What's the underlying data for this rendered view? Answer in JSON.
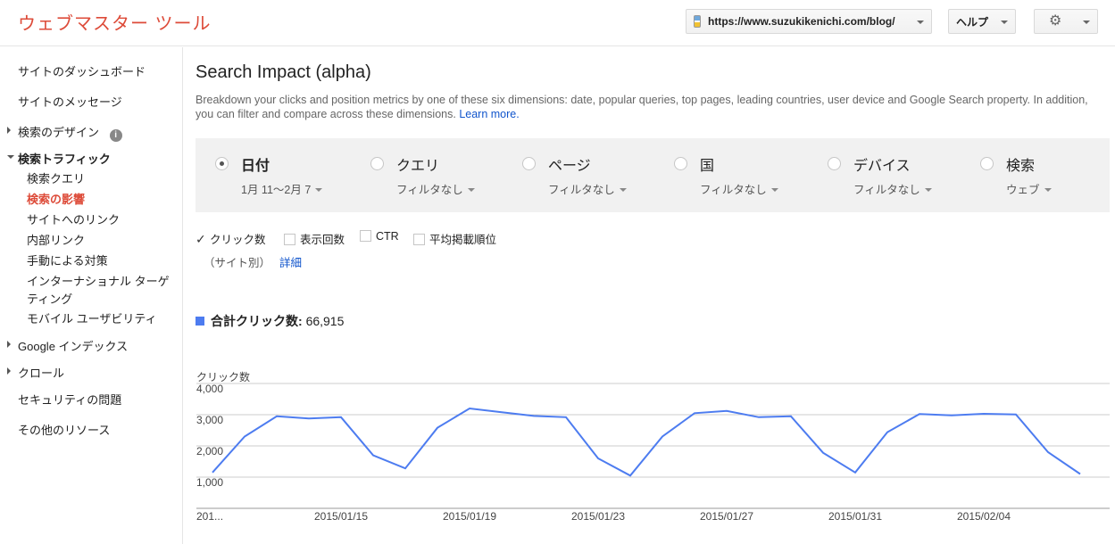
{
  "header": {
    "brand": "ウェブマスター ツール",
    "site_url": "https://www.suzukikenichi.com/blog/",
    "help_label": "ヘルプ",
    "gear_icon": "gear-icon"
  },
  "sidebar": {
    "dashboard": "サイトのダッシュボード",
    "messages": "サイトのメッセージ",
    "search_appearance": "検索のデザイン",
    "search_traffic": "検索トラフィック",
    "search_traffic_items": [
      "検索クエリ",
      "検索の影響",
      "サイトへのリンク",
      "内部リンク",
      "手動による対策",
      "インターナショナル ターゲティング",
      "モバイル ユーザビリティ"
    ],
    "google_index": "Google インデックス",
    "crawl": "クロール",
    "security": "セキュリティの問題",
    "other": "その他のリソース"
  },
  "main": {
    "title": "Search Impact (alpha)",
    "description": "Breakdown your clicks and position metrics by one of these six dimensions: date, popular queries, top pages, leading countries, user device and Google Search property. In addition, you can filter and compare across these dimensions.",
    "learn_more": "Learn more.",
    "dimensions": [
      {
        "label": "日付",
        "filter": "1月 11〜2月 7",
        "selected": true
      },
      {
        "label": "クエリ",
        "filter": "フィルタなし",
        "selected": false
      },
      {
        "label": "ページ",
        "filter": "フィルタなし",
        "selected": false
      },
      {
        "label": "国",
        "filter": "フィルタなし",
        "selected": false
      },
      {
        "label": "デバイス",
        "filter": "フィルタなし",
        "selected": false
      },
      {
        "label": "検索",
        "filter": "ウェブ",
        "selected": false
      }
    ],
    "metrics": [
      {
        "label": "クリック数",
        "checked": true
      },
      {
        "label": "表示回数",
        "checked": false
      },
      {
        "label": "CTR",
        "checked": false
      },
      {
        "label": "平均掲載順位",
        "checked": false
      }
    ],
    "site_note": "（サイト別）",
    "detail_link": "詳細",
    "total_label": "合計クリック数:",
    "total_value": "66,915"
  },
  "colors": {
    "brand": "#dd4b39",
    "series": "#4d7cf0",
    "link": "#1155cc"
  },
  "chart_data": {
    "type": "line",
    "ylabel": "クリック数",
    "ylim": [
      0,
      4000
    ],
    "yticks": [
      "4,000",
      "3,000",
      "2,000",
      "1,000"
    ],
    "ytick_values": [
      4000,
      3000,
      2000,
      1000
    ],
    "xtick_labels": [
      "201...",
      "2015/01/15",
      "2015/01/19",
      "2015/01/23",
      "2015/01/27",
      "2015/01/31",
      "2015/02/04"
    ],
    "x": [
      "2015/01/11",
      "2015/01/12",
      "2015/01/13",
      "2015/01/14",
      "2015/01/15",
      "2015/01/16",
      "2015/01/17",
      "2015/01/18",
      "2015/01/19",
      "2015/01/20",
      "2015/01/21",
      "2015/01/22",
      "2015/01/23",
      "2015/01/24",
      "2015/01/25",
      "2015/01/26",
      "2015/01/27",
      "2015/01/28",
      "2015/01/29",
      "2015/01/30",
      "2015/01/31",
      "2015/02/01",
      "2015/02/02",
      "2015/02/03",
      "2015/02/04",
      "2015/02/05",
      "2015/02/06",
      "2015/02/07"
    ],
    "series": [
      {
        "name": "クリック数",
        "values": [
          1150,
          2300,
          2950,
          2880,
          2920,
          1700,
          1280,
          2580,
          3200,
          3080,
          2960,
          2920,
          1600,
          1050,
          2300,
          3050,
          3120,
          2920,
          2950,
          1780,
          1150,
          2440,
          3020,
          2980,
          3030,
          3010,
          1800,
          1100
        ]
      }
    ]
  }
}
